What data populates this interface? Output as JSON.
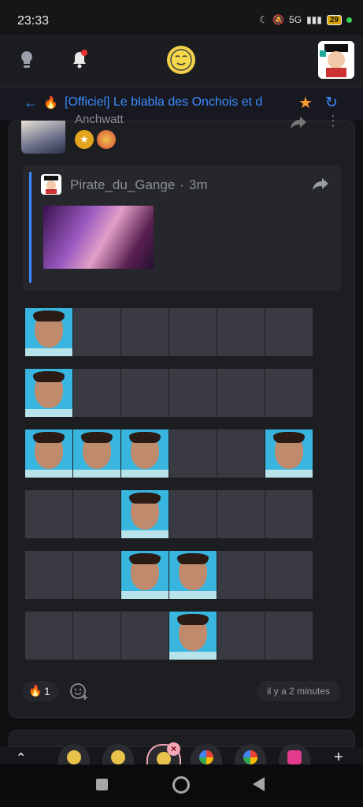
{
  "status_bar": {
    "time": "23:33",
    "network": "5G",
    "battery": "29"
  },
  "topic": {
    "back_label": "←",
    "emoji": "🔥",
    "title": "[Officiel] Le blabla des Onchois et d",
    "star": "★",
    "refresh": "↻"
  },
  "post": {
    "author": "Anchwatt",
    "more": "⋮"
  },
  "quote": {
    "author": "Pirate_du_Gange",
    "separator": "·",
    "time": "3m"
  },
  "grid": {
    "rows": [
      [
        1,
        0,
        0,
        0,
        0,
        0
      ],
      [
        1,
        0,
        0,
        0,
        0,
        0
      ],
      [
        1,
        1,
        1,
        0,
        0,
        1
      ],
      [
        0,
        0,
        1,
        0,
        0,
        0
      ],
      [
        0,
        0,
        1,
        1,
        0,
        0
      ],
      [
        0,
        0,
        0,
        1,
        0,
        0
      ]
    ]
  },
  "footer": {
    "reaction_emoji": "🔥",
    "reaction_count": "1",
    "timestamp": "il y a 2 minutes"
  },
  "tabs": {
    "up": "⌃",
    "close": "×",
    "plus": "+",
    "icons": [
      "onche-emoji-icon",
      "onche-emoji-icon",
      "onche-emoji-icon",
      "google-icon",
      "google-icon",
      "pink-app-icon"
    ]
  },
  "colors": {
    "accent": "#3b8bff",
    "star": "#ff9a2b",
    "background": "#0f1012",
    "card": "#1d1e22"
  }
}
